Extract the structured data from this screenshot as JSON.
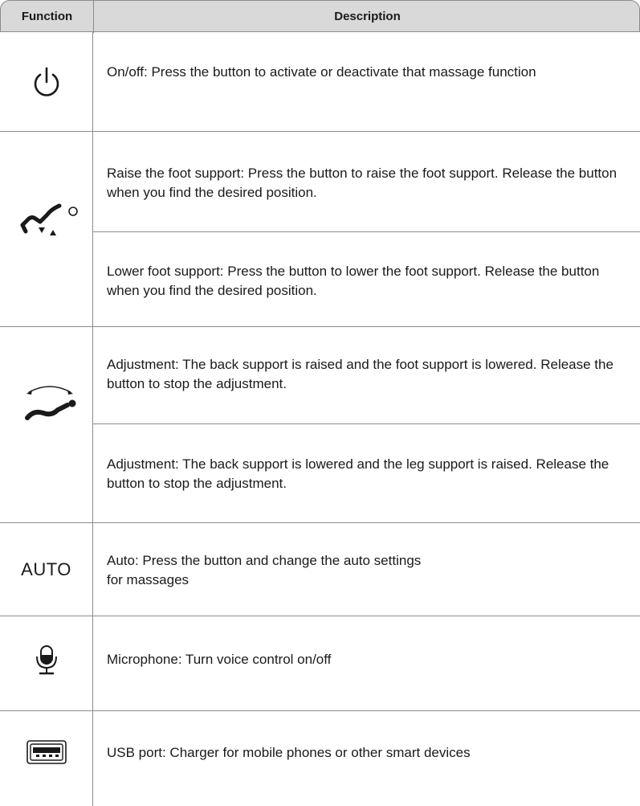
{
  "header": {
    "function_label": "Function",
    "description_label": "Description"
  },
  "rows": [
    {
      "icon": "power-icon",
      "description": "On/off: Press the button to activate or deactivate that massage function"
    },
    {
      "icon": "foot-support-icon",
      "description": "Raise the foot support: Press the button to raise the foot support. Release the button when you find the desired position."
    },
    {
      "icon": "foot-support-icon",
      "description": "Lower foot support: Press the button to lower the foot support. Release the button when you find the desired position."
    },
    {
      "icon": "recline-icon",
      "description": "Adjustment: The back support is raised and the foot support is lowered. Release the button to stop the adjustment."
    },
    {
      "icon": "recline-icon",
      "description": "Adjustment: The back support is lowered and the leg support is raised. Release the button to stop the adjustment."
    },
    {
      "label": "AUTO",
      "description": "Auto: Press the button and change the auto settings for massages",
      "description_lines": [
        "Auto: Press the button and change the auto settings",
        "for massages"
      ]
    },
    {
      "icon": "microphone-icon",
      "description": "Microphone: Turn voice control on/off"
    },
    {
      "icon": "usb-port-icon",
      "description": "USB port: Charger for mobile phones or other smart devices"
    }
  ]
}
